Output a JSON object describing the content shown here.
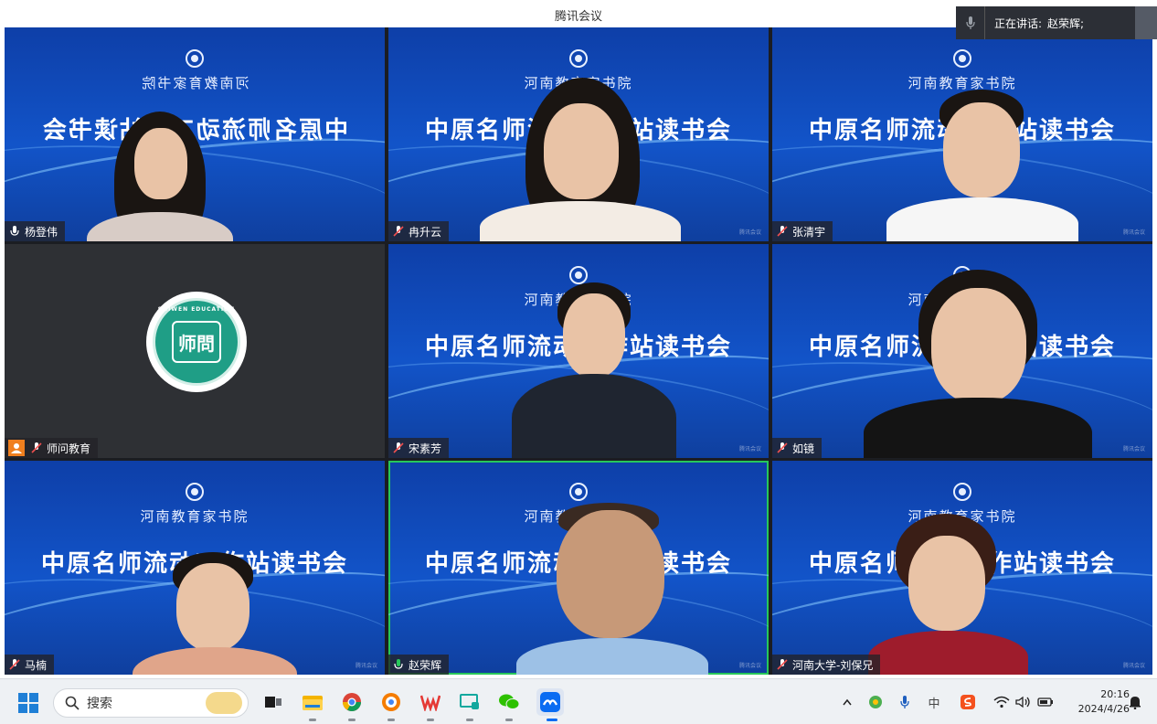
{
  "window": {
    "title": "腾讯会议"
  },
  "speaking": {
    "label": "正在讲话:",
    "name": "赵荣辉;"
  },
  "background": {
    "subtitle": "河南教育家书院",
    "title": "中原名师流动工作站读书会"
  },
  "tiles": [
    {
      "name": "杨登伟",
      "mic": "on"
    },
    {
      "name": "冉升云",
      "mic": "muted"
    },
    {
      "name": "张清宇",
      "mic": "muted"
    },
    {
      "name": "师问教育",
      "mic": "muted",
      "logo_arc": "SHIWEN EDUCATION",
      "logo_text": "师問"
    },
    {
      "name": "宋素芳",
      "mic": "muted"
    },
    {
      "name": "如镜",
      "mic": "muted"
    },
    {
      "name": "马楠",
      "mic": "muted"
    },
    {
      "name": "赵荣辉",
      "mic": "on"
    },
    {
      "name": "河南大学-刘保兄",
      "mic": "muted"
    }
  ],
  "taskbar": {
    "search_placeholder": "搜索",
    "apps": [
      "start-icon",
      "task-view-icon",
      "file-explorer-icon",
      "chrome-icon",
      "browser-icon",
      "wps-icon",
      "remote-desktop-icon",
      "wechat-icon",
      "tencent-meeting-icon"
    ],
    "tray": {
      "ime": "中",
      "clock_time": "20:16",
      "clock_date": "2024/4/26"
    }
  },
  "colors": {
    "active_speaker_border": "#27c75a",
    "tile_bg": "#1254c9",
    "speaking_bar": "#2c2f36"
  }
}
